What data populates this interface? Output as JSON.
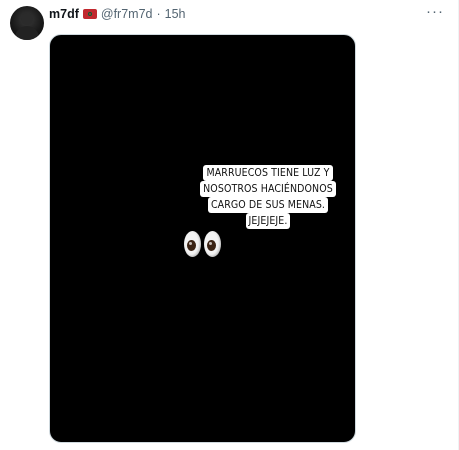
{
  "tweet": {
    "author_name": "m7df",
    "handle": "@fr7m7d",
    "separator": "·",
    "time": "15h",
    "more_icon": "more-horizontal-icon",
    "flag_icon": "morocco-flag-icon"
  },
  "media": {
    "caption_lines": [
      "MARRUECOS TIENE LUZ Y",
      "NOSOTROS HACIÉNDONOS",
      "CARGO DE SUS MENAS.",
      "JEJEJEJE."
    ],
    "emoji": "eyes-emoji",
    "background_color": "#000000"
  }
}
